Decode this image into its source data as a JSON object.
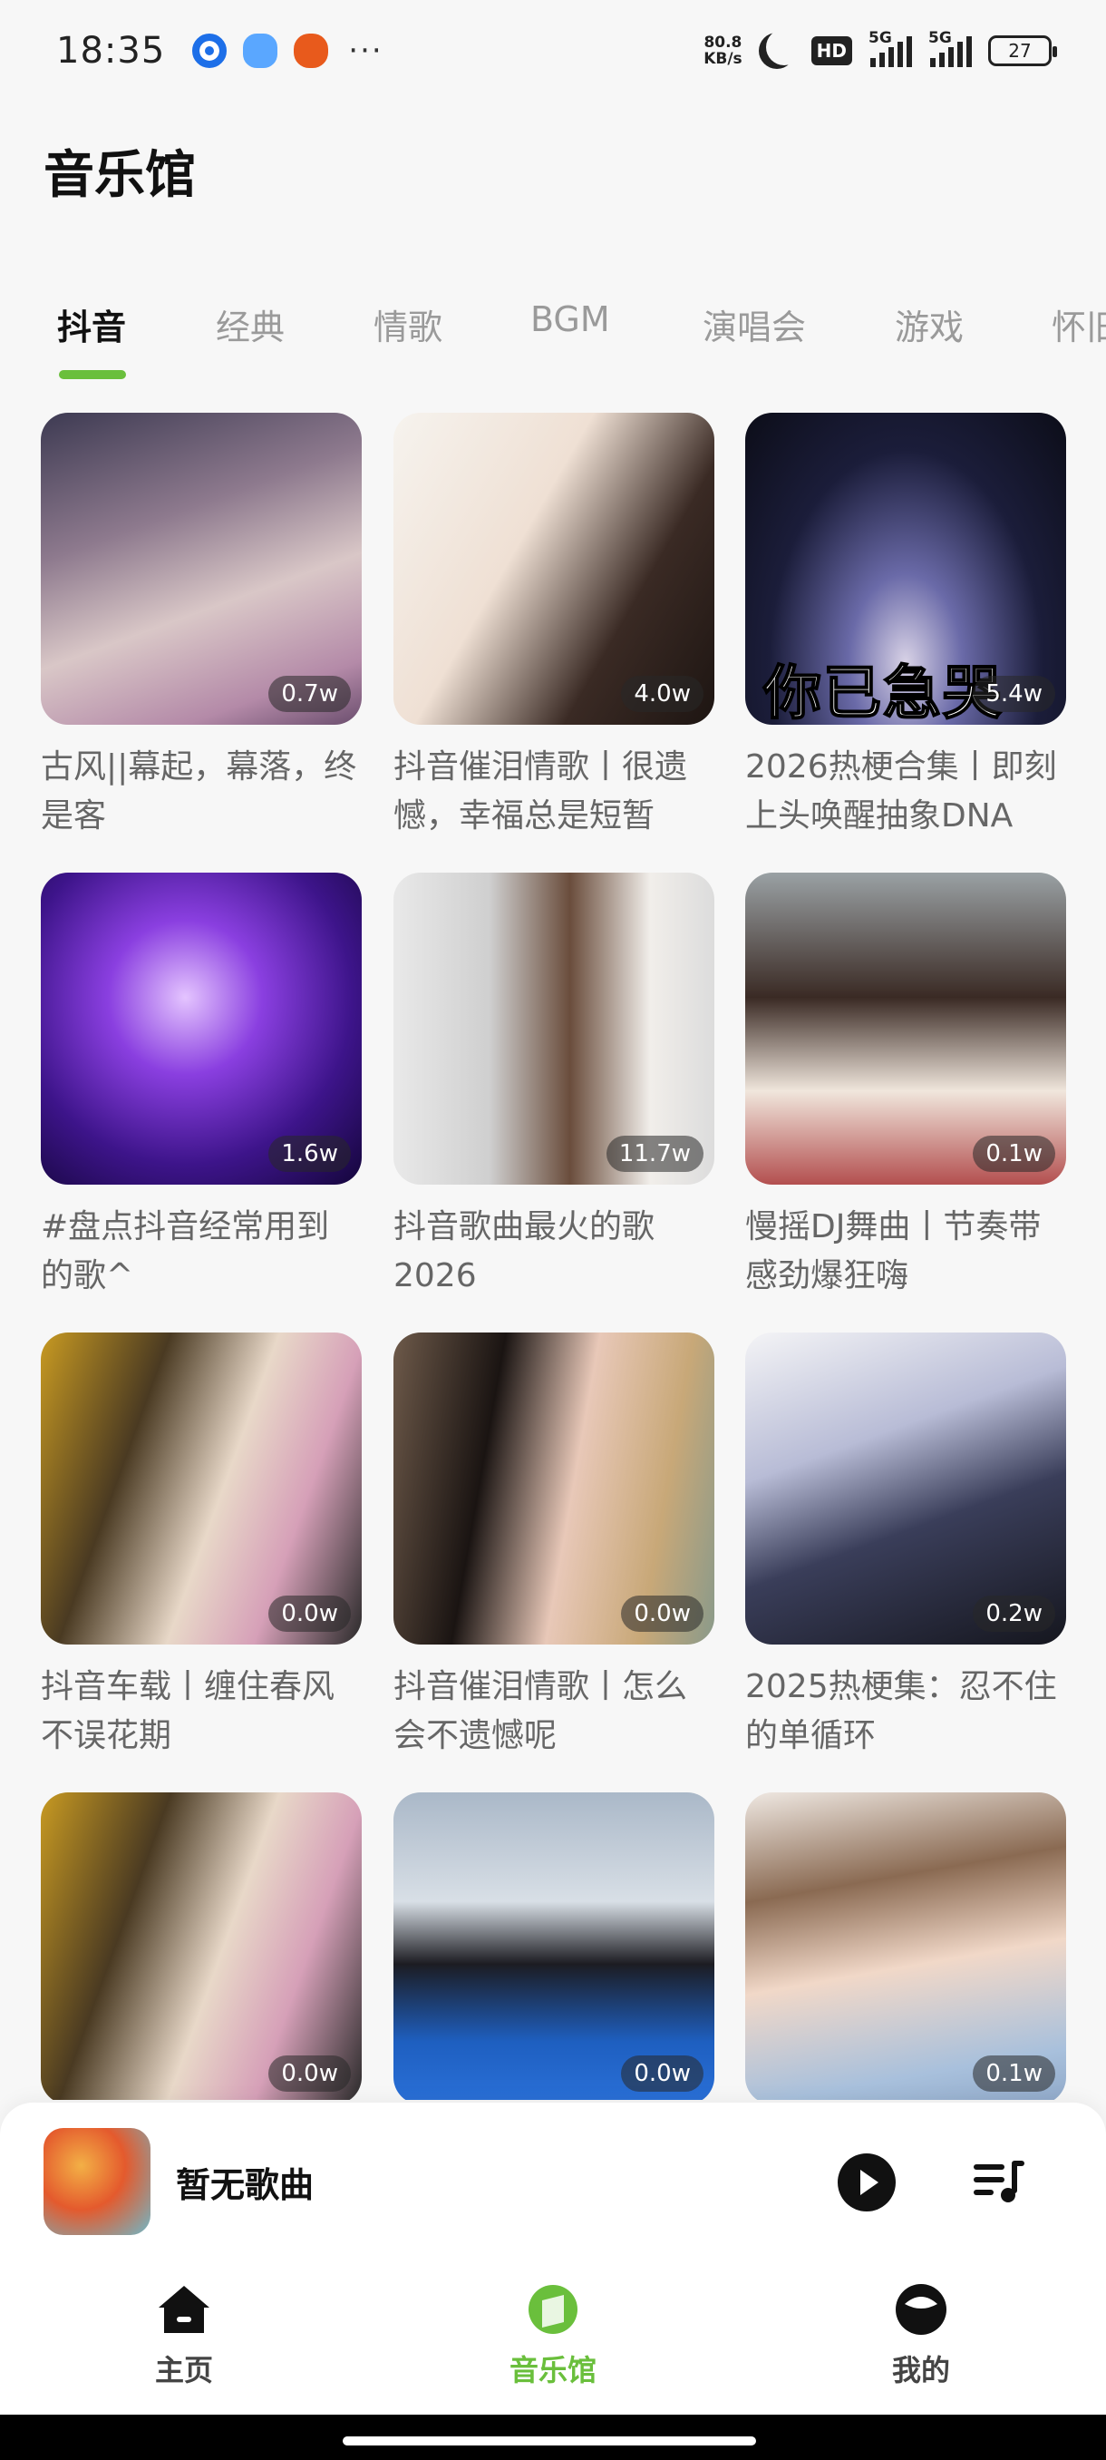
{
  "status_bar": {
    "time": "18:35",
    "more": "···",
    "net_speed_value": "80.8",
    "net_speed_unit": "KB/s",
    "hd_label": "HD",
    "signal1_label": "5G",
    "signal2_label": "5G",
    "battery": "27"
  },
  "page": {
    "title": "音乐馆"
  },
  "tabs": [
    {
      "label": "抖音",
      "active": true
    },
    {
      "label": "经典"
    },
    {
      "label": "情歌"
    },
    {
      "label": "BGM"
    },
    {
      "label": "演唱会"
    },
    {
      "label": "游戏"
    },
    {
      "label": "怀旧"
    }
  ],
  "playlists": [
    {
      "title": "古风||幕起，幕落，终是客",
      "plays": "0.7w"
    },
    {
      "title": "抖音催泪情歌丨很遗憾，幸福总是短暂",
      "plays": "4.0w"
    },
    {
      "title": "2026热梗合集丨即刻上头唤醒抽象DNA",
      "plays": "5.4w",
      "cover_caption": "你已急哭"
    },
    {
      "title": "#盘点抖音经常用到的歌^",
      "plays": "1.6w"
    },
    {
      "title": "抖音歌曲最火的歌2026",
      "plays": "11.7w"
    },
    {
      "title": "慢摇DJ舞曲丨节奏带感劲爆狂嗨",
      "plays": "0.1w"
    },
    {
      "title": "抖音车载丨缠住春风不误花期",
      "plays": "0.0w"
    },
    {
      "title": "抖音催泪情歌丨怎么会不遗憾呢",
      "plays": "0.0w"
    },
    {
      "title": "2025热梗集：忍不住的单循环",
      "plays": "0.2w"
    },
    {
      "title": "",
      "plays": "0.0w"
    },
    {
      "title": "",
      "plays": "0.0w"
    },
    {
      "title": "",
      "plays": "0.1w"
    }
  ],
  "player": {
    "song_title": "暂无歌曲"
  },
  "nav": [
    {
      "label": "主页",
      "icon": "home-icon"
    },
    {
      "label": "音乐馆",
      "icon": "music-hall-icon",
      "active": true
    },
    {
      "label": "我的",
      "icon": "profile-icon"
    }
  ],
  "colors": {
    "accent": "#6abf3c",
    "background": "#f7f7f7"
  }
}
